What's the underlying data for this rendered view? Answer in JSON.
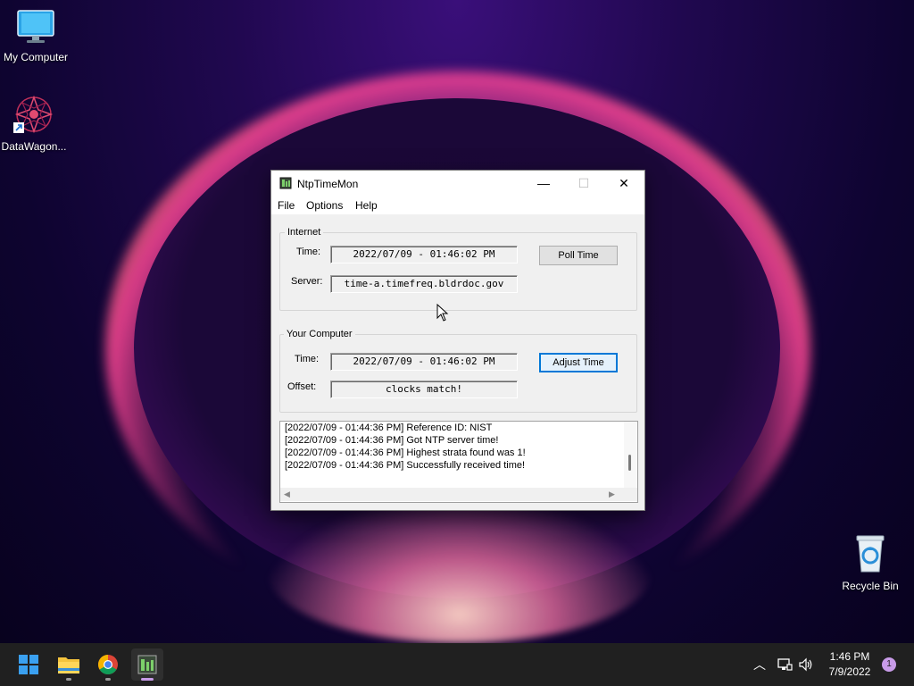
{
  "desktop": {
    "icons": [
      {
        "label": "My Computer",
        "icon": "monitor-icon"
      },
      {
        "label": "DataWagon...",
        "icon": "datawagon-icon"
      },
      {
        "label": "Recycle Bin",
        "icon": "recycle-bin-icon"
      }
    ]
  },
  "window": {
    "title": "NtpTimeMon",
    "controls": {
      "minimize": "—",
      "maximize": "☐",
      "close": "✕"
    },
    "menu": [
      "File",
      "Options",
      "Help"
    ],
    "internet": {
      "group_label": "Internet",
      "time_label": "Time:",
      "time_value": "2022/07/09 - 01:46:02 PM",
      "server_label": "Server:",
      "server_value": "time-a.timefreq.bldrdoc.gov",
      "poll_button": "Poll Time"
    },
    "computer": {
      "group_label": "Your Computer",
      "time_label": "Time:",
      "time_value": "2022/07/09 - 01:46:02 PM",
      "offset_label": "Offset:",
      "offset_value": "clocks match!",
      "adjust_button": "Adjust Time"
    },
    "log": [
      "[2022/07/09 - 01:44:36 PM]     Reference ID: NIST",
      "[2022/07/09 - 01:44:36 PM] Got NTP server time!",
      "[2022/07/09 - 01:44:36 PM] Highest strata found was 1!",
      "[2022/07/09 - 01:44:36 PM] Successfully received time!"
    ]
  },
  "taskbar": {
    "apps": [
      "start-icon",
      "file-explorer-icon",
      "chrome-icon",
      "ntptimemon-icon"
    ],
    "clock_time": "1:46 PM",
    "clock_date": "7/9/2022",
    "notification_count": "1"
  }
}
